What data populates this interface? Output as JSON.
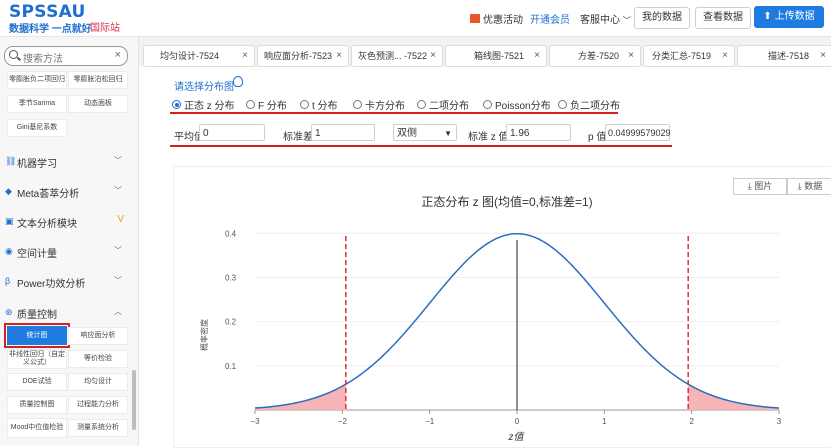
{
  "header": {
    "logo": "SPSSAU",
    "slogan": "数据科学 一点就好",
    "intl": "国际站",
    "promo": "优惠活动",
    "member": "开通会员",
    "service": "客服中心",
    "my_data": "我的数据",
    "view_data": "查看数据",
    "upload": "上传数据"
  },
  "sidebar": {
    "search_placeholder": "搜索方法",
    "top_items": [
      "零膨胀负二项回归",
      "零膨胀泊松回归",
      "季节Sarima",
      "动态面板",
      "Gini基尼系数"
    ],
    "menus": [
      {
        "label": "机器学习",
        "icon": "⛓"
      },
      {
        "label": "Meta荟萃分析",
        "icon": "◆"
      },
      {
        "label": "文本分析模块",
        "icon": "▣"
      },
      {
        "label": "空间计量",
        "icon": "◉"
      },
      {
        "label": "Power功效分析",
        "icon": "β"
      },
      {
        "label": "质量控制",
        "icon": "⊛"
      }
    ],
    "quality_items": [
      {
        "label": "统计图",
        "active": true
      },
      {
        "label": "响应面分析"
      },
      {
        "label": "非线性回归（自定义公式）"
      },
      {
        "label": "等价检验"
      },
      {
        "label": "DOE试验"
      },
      {
        "label": "均匀设计"
      },
      {
        "label": "质量控制图"
      },
      {
        "label": "过程能力分析"
      },
      {
        "label": "Mood中位值检验"
      },
      {
        "label": "测量系统分析"
      }
    ]
  },
  "tabs": [
    "均匀设计-7524",
    "响应面分析-7523",
    "灰色预测... -7522",
    "箱线图-7521",
    "方差-7520",
    "分类汇总-7519",
    "描述-7518"
  ],
  "distribution": {
    "choose_label": "请选择分布图",
    "options": [
      "正态 z 分布",
      "F 分布",
      "t 分布",
      "卡方分布",
      "二项分布",
      "Poisson分布",
      "负二项分布"
    ],
    "selected": 0
  },
  "params": {
    "mean_label": "平均值",
    "mean_value": "0",
    "sd_label": "标准差",
    "sd_value": "1",
    "tail_value": "双侧",
    "z_label": "标准 z 值",
    "z_value": "1.96",
    "p_label": "p 值",
    "p_value": "0.04999579029"
  },
  "chart_tools": {
    "image": "图片",
    "data": "数据"
  },
  "chart_data": {
    "type": "area",
    "title": "正态分布 z 图(均值=0,标准差=1)",
    "xlabel": "z值",
    "ylabel": "概率密度",
    "xlim": [
      -3,
      3
    ],
    "ylim": [
      0,
      0.4
    ],
    "xticks": [
      -3,
      -2,
      -1,
      0,
      1,
      2,
      3
    ],
    "yticks": [
      0.1,
      0.2,
      0.3,
      0.4
    ],
    "mean": 0,
    "sd": 1,
    "critical_values": [
      -1.96,
      1.96
    ],
    "curve_color": "#2a6ebd",
    "tail_fill_color": "#f4b4b8",
    "critical_line_color": "#e02020"
  }
}
